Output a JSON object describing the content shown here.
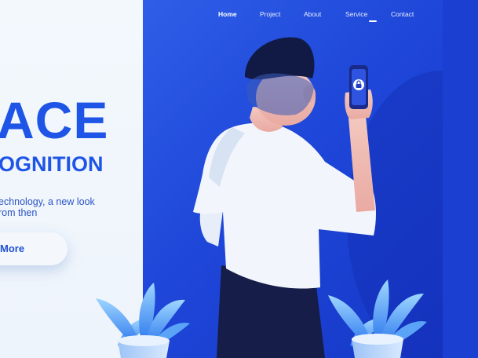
{
  "nav": {
    "items": [
      {
        "label": "Home",
        "active": true
      },
      {
        "label": "Project",
        "active": false
      },
      {
        "label": "About",
        "active": false
      },
      {
        "label": "Service",
        "active": false
      },
      {
        "label": "Contact",
        "active": false
      }
    ]
  },
  "hero": {
    "title_line1": "ACE",
    "title_line2": "OGNITION",
    "description_lines": [
      "echnology, a new look",
      "rom then"
    ],
    "button_label": "More"
  },
  "illustration": {
    "icons": [
      "person-icon",
      "smartphone-icon",
      "lock-icon",
      "plant-icon"
    ]
  },
  "colors": {
    "accent": "#1f55e6",
    "background_right": "#2350e0",
    "left_panel": "#f2f7fc"
  }
}
